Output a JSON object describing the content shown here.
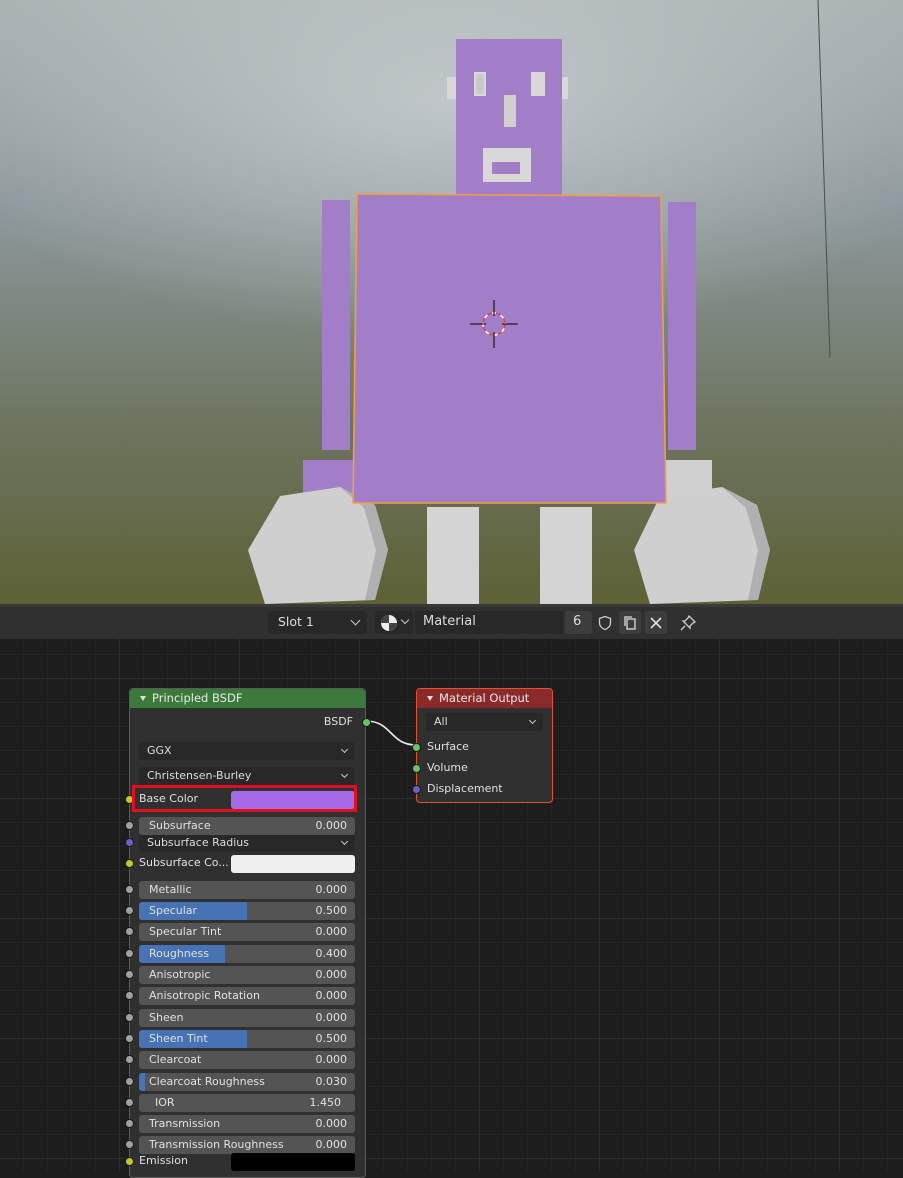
{
  "header": {
    "slot_label": "Slot 1",
    "material_name": "Material",
    "user_count": "6",
    "icons": [
      "material-sphere-icon",
      "fake-user-shield-icon",
      "duplicate-icon",
      "close-icon",
      "pin-icon"
    ]
  },
  "principled_node": {
    "title": "Principled BSDF",
    "header_color": "#3c7a3c",
    "output_label": "BSDF",
    "distribution": "GGX",
    "subsurface_method": "Christensen-Burley",
    "base_color_label": "Base Color",
    "base_color": "#a56ae6",
    "subsurface_radius_label": "Subsurface Radius",
    "subsurface_color_label": "Subsurface Co...",
    "subsurface_color": "#f0f0f0",
    "emission_label": "Emission",
    "emission_color": "#000000",
    "fields": [
      {
        "label": "Subsurface",
        "value": "0.000",
        "fraction": 0
      },
      {
        "label": "Metallic",
        "value": "0.000",
        "fraction": 0
      },
      {
        "label": "Specular",
        "value": "0.500",
        "fraction": 0.5
      },
      {
        "label": "Specular Tint",
        "value": "0.000",
        "fraction": 0
      },
      {
        "label": "Roughness",
        "value": "0.400",
        "fraction": 0.4
      },
      {
        "label": "Anisotropic",
        "value": "0.000",
        "fraction": 0
      },
      {
        "label": "Anisotropic Rotation",
        "value": "0.000",
        "fraction": 0
      },
      {
        "label": "Sheen",
        "value": "0.000",
        "fraction": 0
      },
      {
        "label": "Sheen Tint",
        "value": "0.500",
        "fraction": 0.5
      },
      {
        "label": "Clearcoat",
        "value": "0.000",
        "fraction": 0
      },
      {
        "label": "Clearcoat Roughness",
        "value": "0.030",
        "fraction": 0.03
      },
      {
        "label": "IOR",
        "value": "1.450",
        "fraction": 0
      },
      {
        "label": "Transmission",
        "value": "0.000",
        "fraction": 0
      },
      {
        "label": "Transmission Roughness",
        "value": "0.000",
        "fraction": 0
      }
    ]
  },
  "output_node": {
    "title": "Material Output",
    "header_color": "#8a2a2a",
    "target": "All",
    "inputs": [
      "Surface",
      "Volume",
      "Displacement"
    ]
  },
  "colors": {
    "accent_blue": "#4772b3",
    "highlight_red": "#e01020",
    "robot_purple": "#a27ec8",
    "selection_orange": "#f0a040"
  }
}
